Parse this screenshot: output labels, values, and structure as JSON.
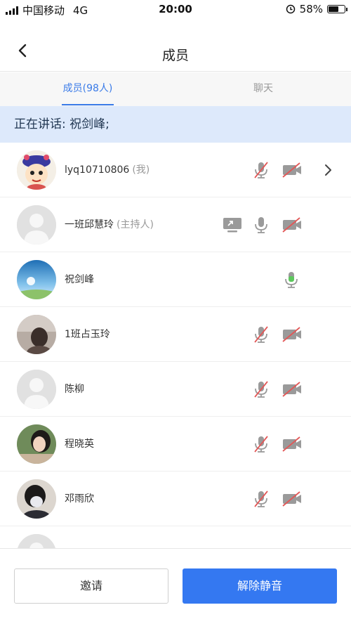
{
  "status_bar": {
    "carrier": "中国移动",
    "network": "4G",
    "time": "20:00",
    "battery": "58%",
    "battery_level": 0.58
  },
  "header": {
    "title": "成员"
  },
  "tabs": [
    {
      "label": "成员(98人)",
      "active": true
    },
    {
      "label": "聊天",
      "active": false
    }
  ],
  "speaking_banner": "正在讲话: 祝剑峰;",
  "members": [
    {
      "name": "lyq10710806",
      "tag": "(我)",
      "mic": "muted",
      "video": "off",
      "share": false,
      "chevron": true
    },
    {
      "name": "一班邱慧玲",
      "tag": "(主持人)",
      "mic": "on",
      "video": "off",
      "share": true,
      "chevron": false
    },
    {
      "name": "祝剑峰",
      "tag": "",
      "mic": "speaking",
      "video": "none",
      "share": false,
      "chevron": false
    },
    {
      "name": "1班占玉玲",
      "tag": "",
      "mic": "muted",
      "video": "off",
      "share": false,
      "chevron": false
    },
    {
      "name": "陈柳",
      "tag": "",
      "mic": "muted",
      "video": "off",
      "share": false,
      "chevron": false
    },
    {
      "name": "程晓英",
      "tag": "",
      "mic": "muted",
      "video": "off",
      "share": false,
      "chevron": false
    },
    {
      "name": "邓雨欣",
      "tag": "",
      "mic": "muted",
      "video": "off",
      "share": false,
      "chevron": false
    }
  ],
  "actions": {
    "invite": "邀请",
    "unmute": "解除静音"
  },
  "colors": {
    "accent": "#3478f1",
    "muted_slash": "#e25757",
    "speaking": "#5cc85c",
    "banner_bg": "#dde9fb"
  },
  "icons": [
    "back-icon",
    "mic-muted-icon",
    "mic-icon",
    "video-off-icon",
    "screen-share-icon",
    "chevron-right-icon",
    "alarm-lock-icon"
  ]
}
